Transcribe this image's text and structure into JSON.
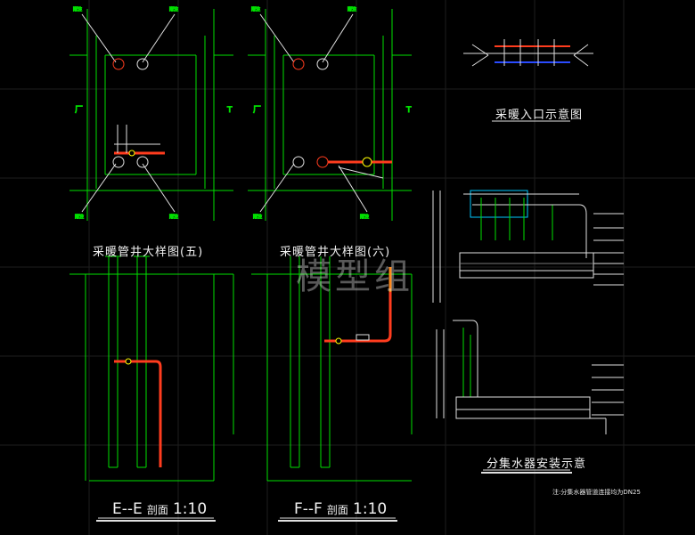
{
  "titles": {
    "detail5": "采暖管井大样图(五)",
    "detail6": "采暖管井大样图(六)",
    "entrance": "采暖入口示意图",
    "manifold": "分集水器安装示意"
  },
  "sections": {
    "ee": {
      "name": "E--E",
      "word": "剖面",
      "scale": "1:10"
    },
    "ff": {
      "name": "F--F",
      "word": "剖面",
      "scale": "1:10"
    }
  },
  "note": "注:分集水器管道连接均为DN25",
  "watermark": "模型组",
  "colors": {
    "background": "#000000",
    "wall": "#00e000",
    "pipe_red": "#ff3c1e",
    "pipe_orange": "#ff8a1e",
    "valve_yellow": "#ffff00",
    "leader_cyan": "#00c8ff",
    "annotation": "#e0e0e0"
  }
}
